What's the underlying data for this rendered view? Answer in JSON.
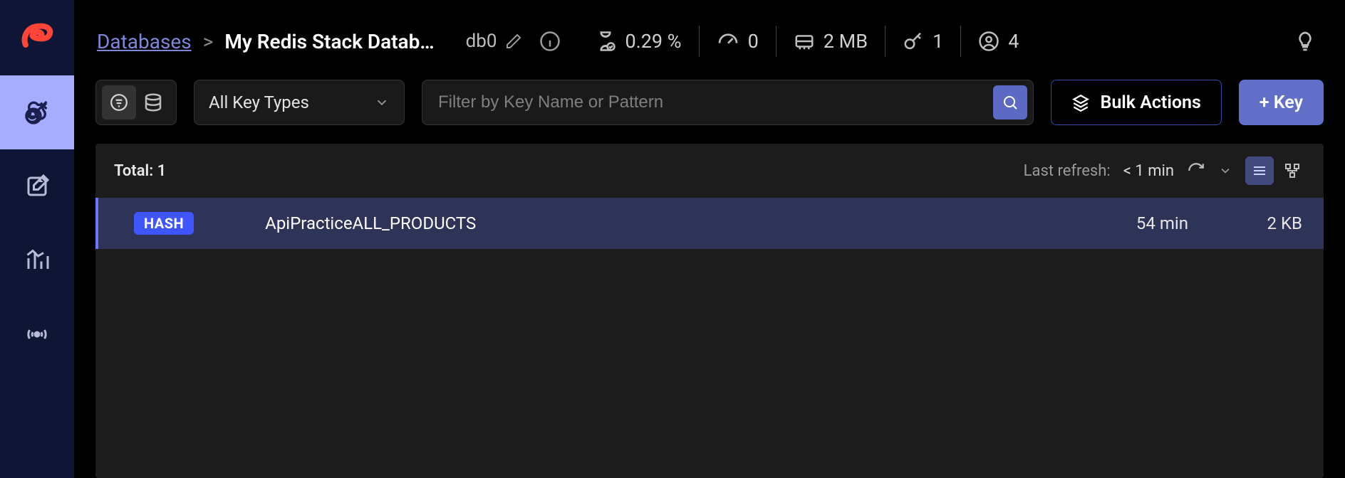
{
  "breadcrumb": {
    "root": "Databases",
    "current": "My Redis Stack Datab…",
    "db": "db0"
  },
  "stats": {
    "cpu": "0.29 %",
    "latency": "0",
    "memory": "2 MB",
    "keys": "1",
    "clients": "4"
  },
  "toolbar": {
    "key_types_label": "All Key Types",
    "search_placeholder": "Filter by Key Name or Pattern",
    "bulk_label": "Bulk Actions",
    "add_key_label": "+ Key"
  },
  "list": {
    "total_label": "Total: 1",
    "refresh_label": "Last refresh:",
    "refresh_value": "< 1 min"
  },
  "rows": [
    {
      "type": "HASH",
      "name": "ApiPracticeALL_PRODUCTS",
      "ttl": "54 min",
      "size": "2 KB"
    }
  ]
}
